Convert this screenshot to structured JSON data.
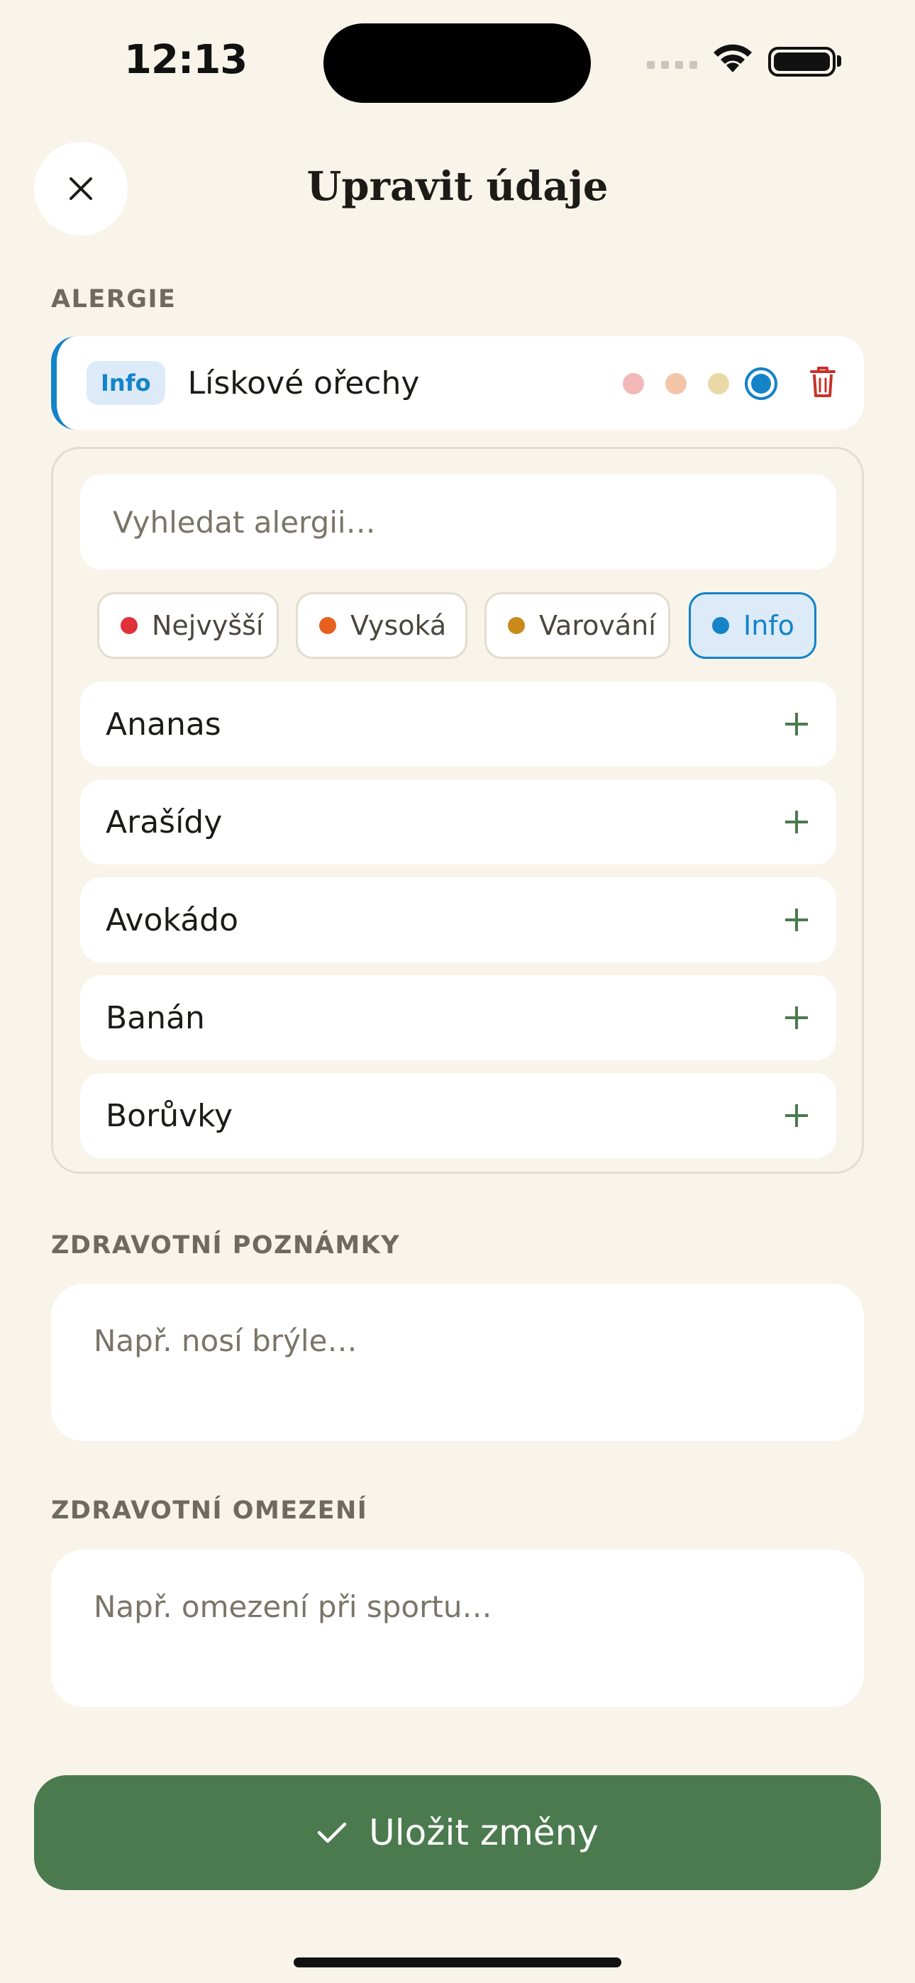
{
  "status_bar": {
    "time": "12:13"
  },
  "header": {
    "title": "Upravit údaje"
  },
  "allergies": {
    "section_label": "ALERGIE",
    "selected": {
      "badge": "Info",
      "name": "Lískové ořechy"
    },
    "severity_colors": {
      "highest": "#f2b8b8",
      "high": "#f4c4a8",
      "warning": "#ead9a6",
      "info": "#1583c8"
    }
  },
  "picker": {
    "search_placeholder": "Vyhledat alergii…",
    "filters": [
      {
        "label": "Nejvyšší",
        "color": "#e0303a"
      },
      {
        "label": "Vysoká",
        "color": "#e8601e"
      },
      {
        "label": "Varování",
        "color": "#c98a1a"
      },
      {
        "label": "Info",
        "color": "#1583c8"
      }
    ],
    "active_filter": "Info",
    "items": [
      "Ananas",
      "Arašídy",
      "Avokádo",
      "Banán",
      "Borůvky"
    ]
  },
  "health_notes": {
    "section_label": "ZDRAVOTNÍ POZNÁMKY",
    "placeholder": "Např. nosí brýle…"
  },
  "health_restrictions": {
    "section_label": "ZDRAVOTNÍ OMEZENÍ",
    "placeholder": "Např. omezení při sportu…"
  },
  "save_button": {
    "label": "Uložit změny"
  }
}
